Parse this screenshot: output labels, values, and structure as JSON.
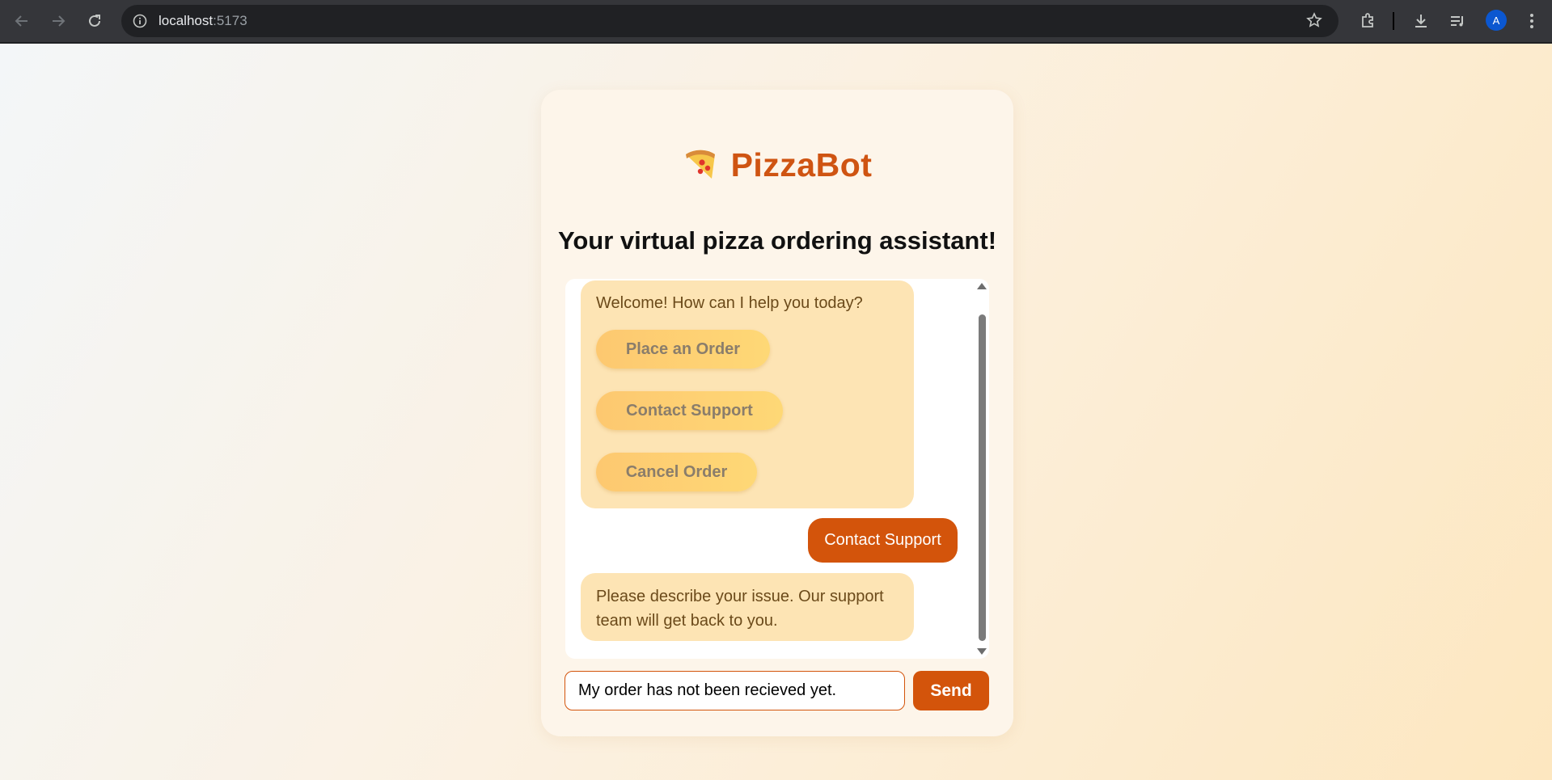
{
  "browser": {
    "url_host": "localhost",
    "url_port": ":5173",
    "avatar_letter": "A"
  },
  "app": {
    "brand_title": "PizzaBot",
    "subtitle": "Your virtual pizza ordering assistant!",
    "brand_icon": "pizza-slice-icon"
  },
  "chat": {
    "welcome_message": "Welcome! How can I help you today?",
    "options": [
      "Place an Order",
      "Contact Support",
      "Cancel Order"
    ],
    "user_message": "Contact Support",
    "bot_reply": "Please describe your issue. Our support team will get back to you."
  },
  "composer": {
    "input_value": "My order has not been recieved yet.",
    "send_label": "Send"
  },
  "colors": {
    "brand": "#cf5412",
    "bot_bubble": "#fde4b4",
    "user_bubble": "#d3540b",
    "option_button": "#fdc870"
  }
}
